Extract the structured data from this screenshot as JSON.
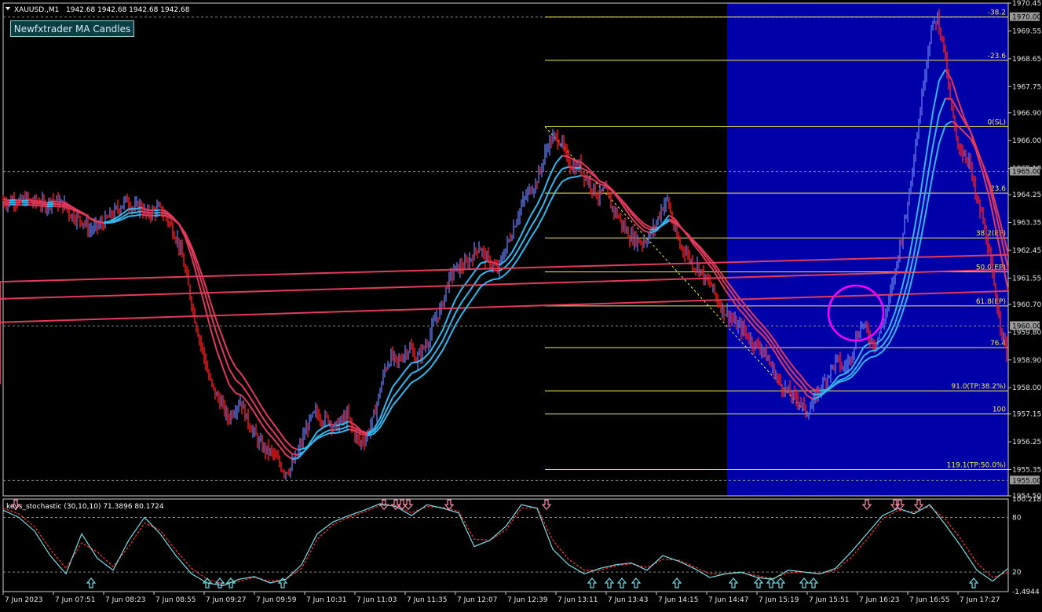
{
  "header": {
    "symbol_label": "XAUUSD.,M1",
    "ohlc": "1942.68 1942.68 1942.68 1942.68",
    "indicator_button": "Newfxtrader MA Candles"
  },
  "colors": {
    "background": "#000000",
    "bull": "#5b72e6",
    "bear": "#ff1a1a",
    "ma_bull": "#33b8f0",
    "ma_bear": "#e33a5c",
    "fib": "#f3f04a",
    "highlight": "#0000a8",
    "circle": "#ff00ff",
    "stoch_main": "#7fe0e8",
    "stoch_signal": "#ff3333",
    "arrow_up": "#6fe0ea",
    "arrow_down": "#ff8fb0"
  },
  "chart_data": [
    {
      "type": "line",
      "title": "XAUUSD.,M1",
      "x_ticks": [
        "7 Jun 2023",
        "7 Jun 07:51",
        "7 Jun 08:23",
        "7 Jun 08:55",
        "7 Jun 09:27",
        "7 Jun 09:59",
        "7 Jun 10:31",
        "7 Jun 11:03",
        "7 Jun 11:35",
        "7 Jun 12:07",
        "7 Jun 12:39",
        "7 Jun 13:11",
        "7 Jun 13:43",
        "7 Jun 14:15",
        "7 Jun 14:47",
        "7 Jun 15:19",
        "7 Jun 15:51",
        "7 Jun 16:23",
        "7 Jun 16:55",
        "7 Jun 17:27"
      ],
      "y_ticks": [
        "1970.45",
        "1969.55",
        "1968.65",
        "1967.75",
        "1966.90",
        "1966.00",
        "1965.10",
        "1964.25",
        "1963.35",
        "1962.45",
        "1961.55",
        "1960.70",
        "1959.80",
        "1958.90",
        "1958.00",
        "1957.15",
        "1956.25",
        "1955.35",
        "1954.50"
      ],
      "ylim": [
        1954.5,
        1970.45
      ],
      "price_tags": [
        "1970.00",
        "1965.00",
        "1960.00",
        "1955.00"
      ],
      "series": [
        {
          "x": [
            0,
            8,
            16,
            24,
            32,
            40,
            48,
            56,
            64,
            72,
            80,
            88,
            96,
            104,
            112,
            120,
            128,
            136,
            144,
            152,
            160,
            168,
            176,
            184,
            192,
            200,
            208,
            216,
            224,
            232,
            240,
            248,
            256,
            264,
            272,
            280,
            288,
            296,
            304,
            312,
            320,
            328,
            336,
            344,
            352,
            360,
            368,
            376,
            384,
            392,
            400,
            408,
            416,
            424,
            432,
            440,
            448,
            456,
            464,
            472,
            480,
            488,
            496,
            504,
            512,
            520,
            528,
            536,
            544,
            552,
            560,
            568,
            576,
            584,
            592,
            600,
            608,
            616,
            624,
            632,
            640,
            648,
            656,
            664,
            672,
            680,
            688,
            696,
            704,
            712,
            720,
            728,
            736,
            744,
            752,
            760,
            768,
            776,
            784,
            792,
            800,
            808,
            816,
            824,
            832,
            840,
            848,
            856,
            864,
            872,
            880,
            888,
            896,
            904,
            912,
            920,
            928,
            936,
            944,
            952,
            960,
            968,
            976,
            984,
            992,
            1000,
            1008,
            1016,
            1024,
            1032,
            1040,
            1048,
            1056,
            1064,
            1072,
            1080,
            1088,
            1096,
            1104,
            1112,
            1120,
            1128,
            1136,
            1144,
            1152,
            1160,
            1168,
            1176,
            1184,
            1192,
            1200,
            1208,
            1216,
            1224,
            1232,
            1240,
            1248,
            1256,
            1264,
            1272,
            1280
          ],
          "close": [
            1964.1,
            1964.0,
            1964.1,
            1964.0,
            1964.1,
            1964.0,
            1964.0,
            1963.9,
            1964.1,
            1964.0,
            1963.9,
            1963.6,
            1963.5,
            1963.4,
            1963.1,
            1963.2,
            1963.3,
            1963.5,
            1963.7,
            1963.9,
            1964.1,
            1963.8,
            1963.9,
            1963.6,
            1963.7,
            1963.8,
            1963.6,
            1963.2,
            1962.8,
            1962.0,
            1961.0,
            1960.0,
            1959.2,
            1958.3,
            1957.8,
            1957.5,
            1957.0,
            1957.3,
            1957.6,
            1957.0,
            1956.6,
            1956.2,
            1956.0,
            1955.9,
            1955.6,
            1955.3,
            1955.4,
            1955.8,
            1956.4,
            1956.9,
            1957.2,
            1957.0,
            1957.0,
            1956.7,
            1956.9,
            1957.1,
            1956.6,
            1956.2,
            1956.4,
            1956.9,
            1957.7,
            1958.6,
            1959.0,
            1958.8,
            1959.1,
            1959.3,
            1958.9,
            1959.2,
            1959.6,
            1960.2,
            1960.6,
            1961.4,
            1961.8,
            1961.9,
            1962.0,
            1962.3,
            1962.6,
            1962.2,
            1962.0,
            1961.8,
            1962.4,
            1962.9,
            1963.5,
            1964.0,
            1964.4,
            1964.6,
            1965.2,
            1965.9,
            1966.1,
            1966.0,
            1965.4,
            1965.1,
            1965.2,
            1964.8,
            1964.5,
            1964.2,
            1964.4,
            1963.9,
            1963.6,
            1963.2,
            1962.9,
            1962.8,
            1962.7,
            1962.9,
            1963.2,
            1963.8,
            1964.1,
            1963.2,
            1962.6,
            1962.4,
            1962.0,
            1961.9,
            1961.5,
            1961.3,
            1960.8,
            1960.5,
            1960.3,
            1960.0,
            1959.9,
            1959.6,
            1959.4,
            1959.3,
            1958.9,
            1958.5,
            1958.1,
            1957.9,
            1957.7,
            1957.6,
            1957.2,
            1957.4,
            1957.9,
            1958.2,
            1958.6,
            1958.9,
            1958.6,
            1958.9,
            1959.6,
            1960.1,
            1959.7,
            1959.4,
            1959.9,
            1960.6,
            1961.5,
            1962.6,
            1963.6,
            1965.2,
            1966.6,
            1968.3,
            1969.6,
            1970.0,
            1969.0,
            1967.3,
            1966.0,
            1965.6,
            1965.4,
            1964.2,
            1963.6,
            1962.6,
            1961.2,
            1960.1,
            1959.1,
            1958.1,
            1957.6,
            1957.2,
            1957.5,
            1957.9
          ]
        }
      ],
      "fibonacci": {
        "levels": [
          {
            "label": "-38.2",
            "price": 1970.0
          },
          {
            "label": "-23.6",
            "price": 1968.6
          },
          {
            "label": "0(SL)",
            "price": 1966.45
          },
          {
            "label": "23.6",
            "price": 1964.3
          },
          {
            "label": "38.2(EP)",
            "price": 1962.85
          },
          {
            "label": "50.0(EP)",
            "price": 1961.75
          },
          {
            "label": "61.8(EP)",
            "price": 1960.65
          },
          {
            "label": "76.4",
            "price": 1959.3
          },
          {
            "label": "91.0(TP:38.2%)",
            "price": 1957.9
          },
          {
            "label": "100",
            "price": 1957.15
          },
          {
            "label": "119.1(TP:50.0%)",
            "price": 1955.35
          }
        ]
      }
    },
    {
      "type": "line",
      "title": "keys_stochastic (30,10,10) 71.3896 80.1724",
      "y_ticks": [
        "100.2189",
        "80",
        "20",
        "-1.4944"
      ],
      "ylim": [
        -1.4944,
        100.2189
      ],
      "series": [
        {
          "name": "main",
          "x": [
            0,
            20,
            40,
            60,
            80,
            100,
            120,
            140,
            160,
            180,
            200,
            220,
            240,
            260,
            280,
            300,
            320,
            340,
            360,
            380,
            400,
            420,
            440,
            460,
            480,
            500,
            520,
            540,
            560,
            580,
            600,
            620,
            640,
            660,
            680,
            700,
            720,
            740,
            760,
            780,
            800,
            820,
            840,
            860,
            880,
            900,
            920,
            940,
            960,
            980,
            1000,
            1020,
            1040,
            1060,
            1080,
            1100,
            1120,
            1140,
            1160,
            1180,
            1200,
            1220,
            1240,
            1260,
            1280
          ],
          "values": [
            88,
            80,
            65,
            38,
            18,
            62,
            35,
            22,
            55,
            80,
            62,
            38,
            18,
            8,
            5,
            12,
            15,
            8,
            12,
            28,
            62,
            75,
            82,
            88,
            95,
            92,
            82,
            94,
            90,
            85,
            48,
            55,
            70,
            94,
            90,
            45,
            28,
            18,
            24,
            28,
            30,
            22,
            38,
            32,
            24,
            14,
            18,
            20,
            14,
            12,
            22,
            20,
            18,
            24,
            42,
            62,
            82,
            90,
            84,
            94,
            72,
            48,
            22,
            10,
            24
          ]
        },
        {
          "name": "signal",
          "x": [
            0,
            20,
            40,
            60,
            80,
            100,
            120,
            140,
            160,
            180,
            200,
            220,
            240,
            260,
            280,
            300,
            320,
            340,
            360,
            380,
            400,
            420,
            440,
            460,
            480,
            500,
            520,
            540,
            560,
            580,
            600,
            620,
            640,
            660,
            680,
            700,
            720,
            740,
            760,
            780,
            800,
            820,
            840,
            860,
            880,
            900,
            920,
            940,
            960,
            980,
            1000,
            1020,
            1040,
            1060,
            1080,
            1100,
            1120,
            1140,
            1160,
            1180,
            1200,
            1220,
            1240,
            1260,
            1280
          ],
          "values": [
            90,
            84,
            70,
            45,
            24,
            52,
            42,
            26,
            48,
            74,
            66,
            44,
            24,
            12,
            7,
            10,
            14,
            10,
            12,
            24,
            56,
            72,
            80,
            86,
            93,
            93,
            85,
            92,
            91,
            87,
            56,
            55,
            66,
            90,
            91,
            55,
            34,
            22,
            22,
            27,
            29,
            25,
            34,
            33,
            26,
            18,
            18,
            19,
            16,
            13,
            19,
            20,
            18,
            22,
            36,
            56,
            78,
            88,
            86,
            92,
            78,
            56,
            30,
            14,
            20
          ]
        }
      ],
      "signals_up": [
        112,
        260,
        276,
        290,
        356,
        750,
        772,
        788,
        806,
        858,
        930,
        962,
        978,
        990,
        1020,
        1032,
        1236
      ],
      "signals_down": [
        16,
        485,
        500,
        508,
        516,
        568,
        692,
        1100,
        1136,
        1142,
        1166
      ]
    }
  ]
}
